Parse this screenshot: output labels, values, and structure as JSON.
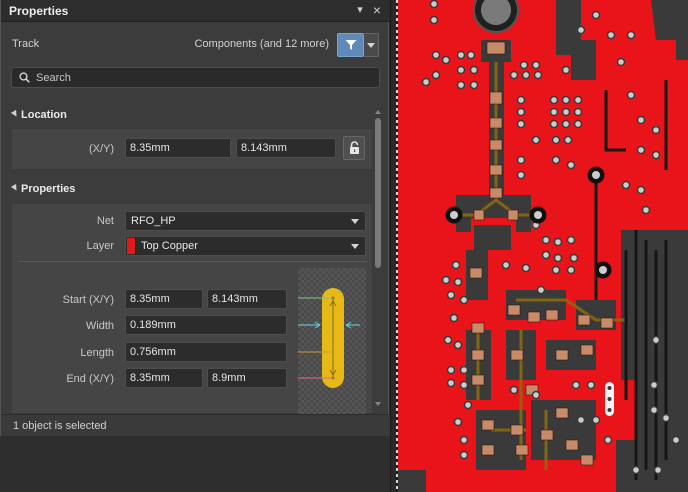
{
  "panel": {
    "title": "Properties",
    "pin_glyph": "▾",
    "close_glyph": "×",
    "object_kind": "Track",
    "filter_summary": "Components (and 12 more)",
    "filter_icon": "funnel-icon"
  },
  "search": {
    "placeholder": "Search",
    "value": ""
  },
  "location": {
    "section_label": "Location",
    "xy_label": "(X/Y)",
    "x": "8.35mm",
    "y": "8.143mm",
    "lock_icon": "lock-icon"
  },
  "properties": {
    "section_label": "Properties",
    "net_label": "Net",
    "net_value": "RFO_HP",
    "layer_label": "Layer",
    "layer_value": "Top Copper",
    "layer_color": "#e01919",
    "start_label": "Start (X/Y)",
    "start_x": "8.35mm",
    "start_y": "8.143mm",
    "width_label": "Width",
    "width_value": "0.189mm",
    "length_label": "Length",
    "length_value": "0.756mm",
    "end_label": "End (X/Y)",
    "end_x": "8.35mm",
    "end_y": "8.9mm"
  },
  "status": {
    "text": "1 object is selected"
  },
  "colors": {
    "accent": "#5f8ab8",
    "panel_bg": "#3c3c3c",
    "pcb_copper": "#e8141a",
    "track_yellow": "#e7b918"
  }
}
